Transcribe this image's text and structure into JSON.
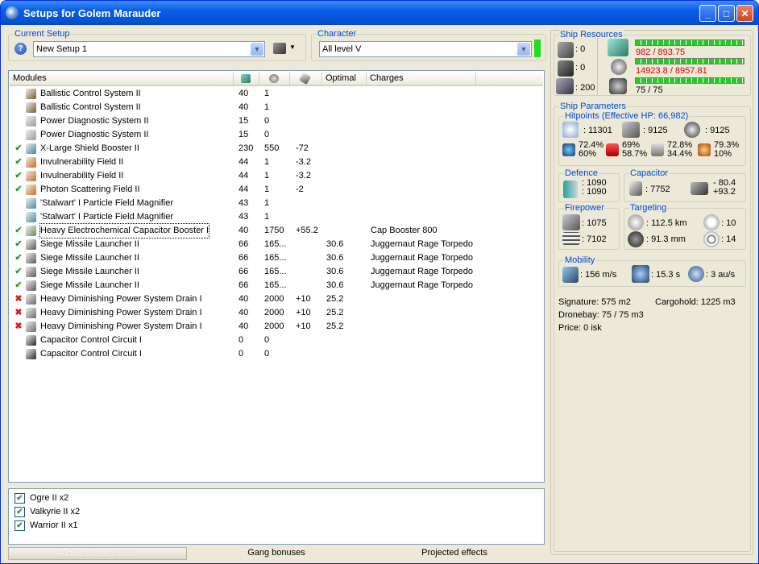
{
  "window": {
    "title": "Setups for Golem Marauder"
  },
  "current_setup": {
    "label": "Current Setup",
    "value": "New Setup 1"
  },
  "character": {
    "label": "Character",
    "value": "All level V"
  },
  "modules_header": {
    "modules": "Modules",
    "optimal": "Optimal",
    "charges": "Charges"
  },
  "modules": [
    {
      "status": "",
      "name": "Ballistic Control System II",
      "v1": "40",
      "v2": "1",
      "v3": "",
      "optimal": "",
      "charge": "",
      "color": "#7a5a30"
    },
    {
      "status": "",
      "name": "Ballistic Control System II",
      "v1": "40",
      "v2": "1",
      "v3": "",
      "optimal": "",
      "charge": "",
      "color": "#7a5a30"
    },
    {
      "status": "",
      "name": "Power Diagnostic System II",
      "v1": "15",
      "v2": "0",
      "v3": "",
      "optimal": "",
      "charge": "",
      "color": "#9a9a9a"
    },
    {
      "status": "",
      "name": "Power Diagnostic System II",
      "v1": "15",
      "v2": "0",
      "v3": "",
      "optimal": "",
      "charge": "",
      "color": "#9a9a9a"
    },
    {
      "status": "ok",
      "name": "X-Large Shield Booster II",
      "v1": "230",
      "v2": "550",
      "v3": "-72",
      "optimal": "",
      "charge": "",
      "color": "#3a8a9a"
    },
    {
      "status": "ok",
      "name": "Invulnerability Field II",
      "v1": "44",
      "v2": "1",
      "v3": "-3.2",
      "optimal": "",
      "charge": "",
      "color": "#c86a20"
    },
    {
      "status": "ok",
      "name": "Invulnerability Field II",
      "v1": "44",
      "v2": "1",
      "v3": "-3.2",
      "optimal": "",
      "charge": "",
      "color": "#c86a20"
    },
    {
      "status": "ok",
      "name": "Photon Scattering Field II",
      "v1": "44",
      "v2": "1",
      "v3": "-2",
      "optimal": "",
      "charge": "",
      "color": "#c86a20"
    },
    {
      "status": "",
      "name": "'Stalwart' I Particle Field Magnifier",
      "v1": "43",
      "v2": "1",
      "v3": "",
      "optimal": "",
      "charge": "",
      "color": "#4a8aa0"
    },
    {
      "status": "",
      "name": "'Stalwart' I Particle Field Magnifier",
      "v1": "43",
      "v2": "1",
      "v3": "",
      "optimal": "",
      "charge": "",
      "color": "#4a8aa0"
    },
    {
      "status": "ok",
      "name": "Heavy Electrochemical Capacitor Booster I",
      "v1": "40",
      "v2": "1750",
      "v3": "+55.2",
      "optimal": "",
      "charge": "Cap Booster 800",
      "color": "#6a8a5a",
      "focus": true
    },
    {
      "status": "ok",
      "name": "Siege Missile Launcher II",
      "v1": "66",
      "v2": "165...",
      "v3": "",
      "optimal": "30.6",
      "charge": "Juggernaut Rage Torpedo",
      "color": "#5a5a5a"
    },
    {
      "status": "ok",
      "name": "Siege Missile Launcher II",
      "v1": "66",
      "v2": "165...",
      "v3": "",
      "optimal": "30.6",
      "charge": "Juggernaut Rage Torpedo",
      "color": "#5a5a5a"
    },
    {
      "status": "ok",
      "name": "Siege Missile Launcher II",
      "v1": "66",
      "v2": "165...",
      "v3": "",
      "optimal": "30.6",
      "charge": "Juggernaut Rage Torpedo",
      "color": "#5a5a5a"
    },
    {
      "status": "ok",
      "name": "Siege Missile Launcher II",
      "v1": "66",
      "v2": "165...",
      "v3": "",
      "optimal": "30.6",
      "charge": "Juggernaut Rage Torpedo",
      "color": "#5a5a5a"
    },
    {
      "status": "err",
      "name": "Heavy Diminishing Power System Drain I",
      "v1": "40",
      "v2": "2000",
      "v3": "+10",
      "optimal": "25.2",
      "charge": "",
      "color": "#6a6a6a"
    },
    {
      "status": "err",
      "name": "Heavy Diminishing Power System Drain I",
      "v1": "40",
      "v2": "2000",
      "v3": "+10",
      "optimal": "25.2",
      "charge": "",
      "color": "#6a6a6a"
    },
    {
      "status": "err",
      "name": "Heavy Diminishing Power System Drain I",
      "v1": "40",
      "v2": "2000",
      "v3": "+10",
      "optimal": "25.2",
      "charge": "",
      "color": "#6a6a6a"
    },
    {
      "status": "",
      "name": "Capacitor Control Circuit I",
      "v1": "0",
      "v2": "0",
      "v3": "",
      "optimal": "",
      "charge": "",
      "color": "#2a2a2a"
    },
    {
      "status": "",
      "name": "Capacitor Control Circuit I",
      "v1": "0",
      "v2": "0",
      "v3": "",
      "optimal": "",
      "charge": "",
      "color": "#2a2a2a"
    }
  ],
  "status_glyphs": {
    "ok": "✔",
    "err": "✖"
  },
  "drones": [
    {
      "name": "Ogre II x2"
    },
    {
      "name": "Valkyrie II x2"
    },
    {
      "name": "Warrior II x1"
    }
  ],
  "check_glyph": "✔",
  "bottom_tabs": {
    "active_drones": "Active drones: 5 / 5",
    "gang": "Gang bonuses",
    "projected": "Projected effects"
  },
  "ship_resources": {
    "label": "Ship Resources",
    "turrets": ": 0",
    "launchers": ": 0",
    "calibration": ": 200",
    "cpu": "982 / 893.75",
    "powergrid": "14923.8 / 8957.81",
    "drones": "75 / 75"
  },
  "ship_parameters": {
    "label": "Ship Parameters",
    "hitpoints": {
      "label": "Hitpoints (Effective HP: 66,982)",
      "shield": ": 11301",
      "armor": ": 9125",
      "structure": ": 9125",
      "r1a": "72.4%",
      "r1b": "60%",
      "r2a": "69%",
      "r2b": "58.7%",
      "r3a": "72.8%",
      "r3b": "34.4%",
      "r4a": "79.3%",
      "r4b": "10%"
    },
    "defence": {
      "label": "Defence",
      "a": ": 1090",
      "b": ": 1090"
    },
    "capacitor": {
      "label": "Capacitor",
      "amount": ": 7752",
      "a": "- 80.4",
      "b": "+93.2"
    },
    "firepower": {
      "label": "Firepower",
      "a": ": 1075",
      "b": ": 7102"
    },
    "targeting": {
      "label": "Targeting",
      "range": ": 112.5 km",
      "targets": ": 10",
      "res": ": 91.3 mm",
      "sensor": ": 14"
    },
    "mobility": {
      "label": "Mobility",
      "speed": ": 156 m/s",
      "align": ": 15.3 s",
      "warp": ": 3 au/s"
    },
    "signature": "Signature: 575 m2",
    "cargohold": "Cargohold: 1225 m3",
    "dronebay": "Dronebay: 75 / 75 m3",
    "price": "Price: 0 isk"
  }
}
